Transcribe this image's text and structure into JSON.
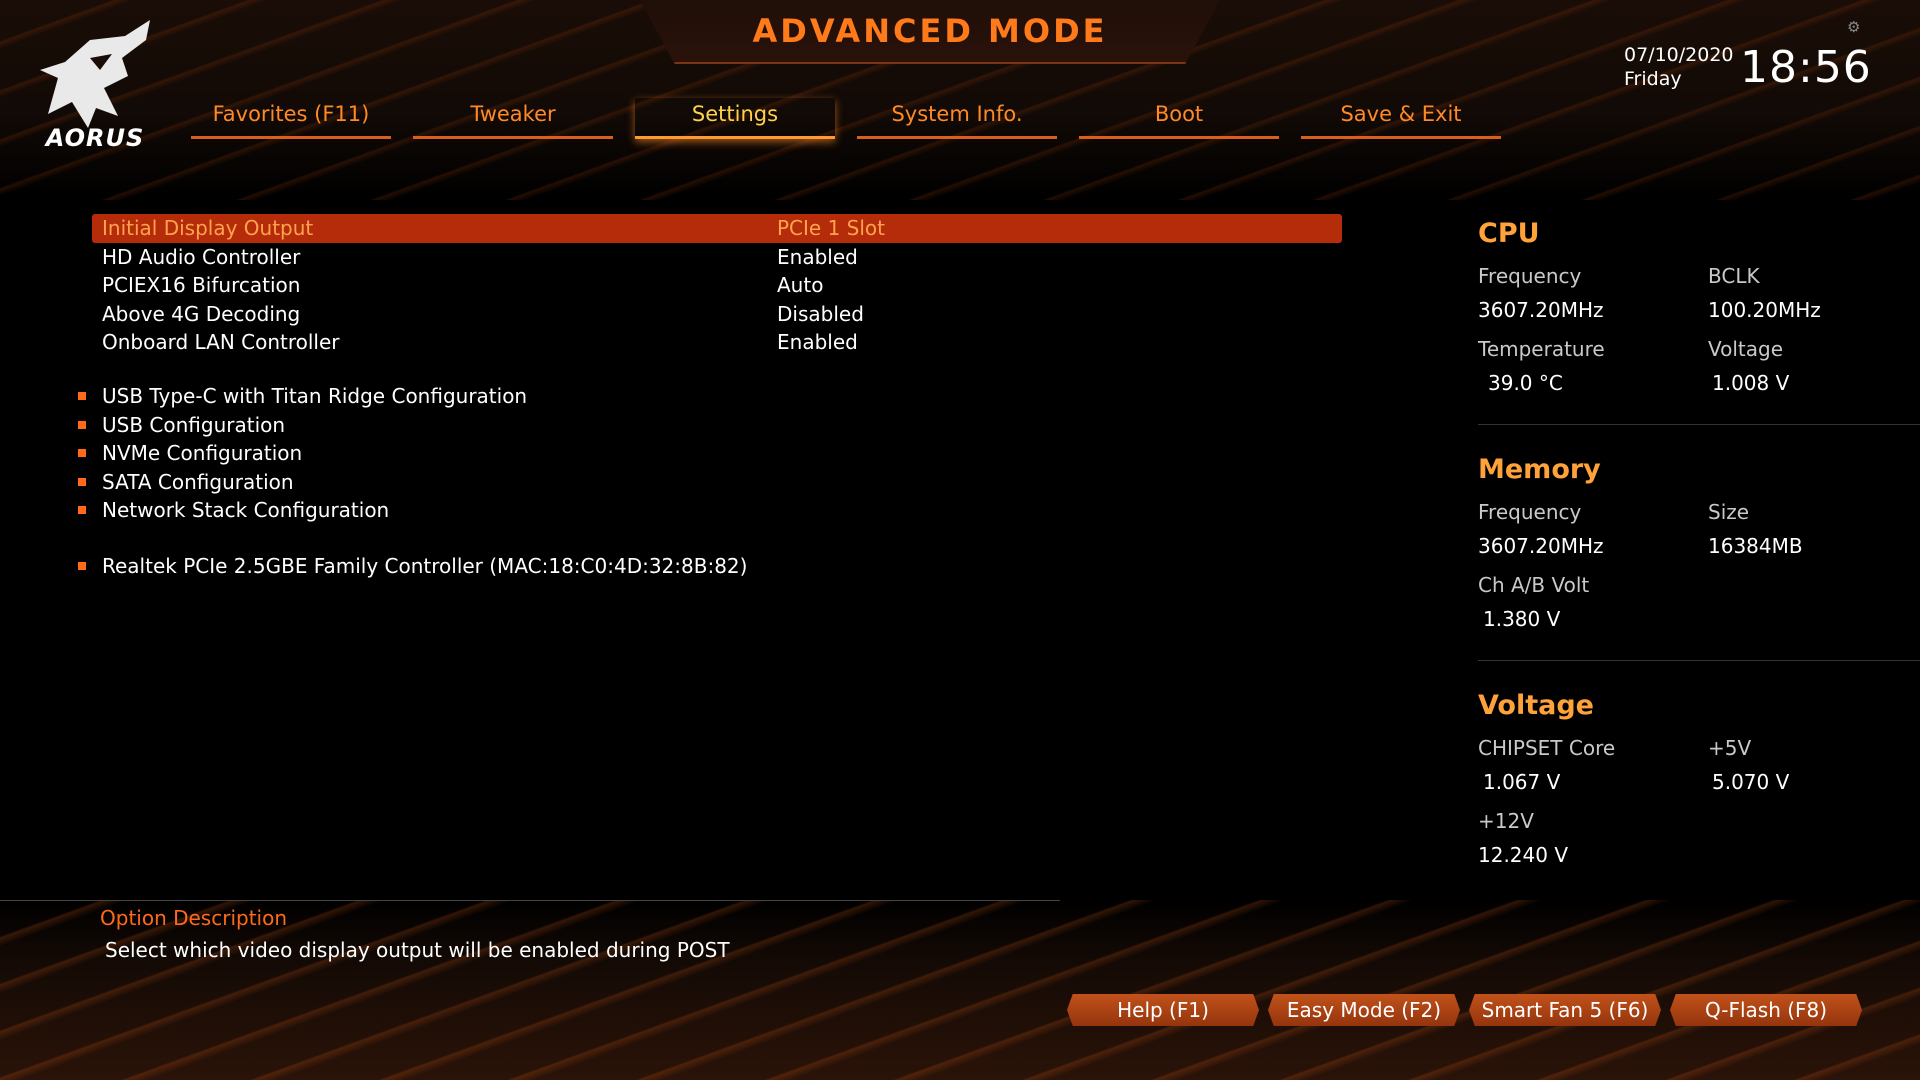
{
  "brand": {
    "logo_text": "AORUS"
  },
  "header": {
    "title": "ADVANCED MODE",
    "date": "07/10/2020",
    "day": "Friday",
    "time": "18:56"
  },
  "tabs": [
    {
      "label": "Favorites (F11)"
    },
    {
      "label": "Tweaker"
    },
    {
      "label": "Settings",
      "active": true
    },
    {
      "label": "System Info."
    },
    {
      "label": "Boot"
    },
    {
      "label": "Save & Exit"
    }
  ],
  "settings": [
    {
      "label": "Initial Display Output",
      "value": "PCIe 1 Slot",
      "selected": true
    },
    {
      "label": "HD Audio Controller",
      "value": "Enabled"
    },
    {
      "label": "PCIEX16 Bifurcation",
      "value": "Auto"
    },
    {
      "label": "Above 4G Decoding",
      "value": "Disabled"
    },
    {
      "label": "Onboard LAN Controller",
      "value": "Enabled"
    }
  ],
  "submenus": [
    {
      "label": "USB Type-C with Titan Ridge Configuration"
    },
    {
      "label": "USB Configuration"
    },
    {
      "label": "NVMe Configuration"
    },
    {
      "label": "SATA Configuration"
    },
    {
      "label": "Network Stack Configuration"
    }
  ],
  "network_devices": [
    {
      "label": "Realtek PCIe 2.5GBE Family Controller (MAC:18:C0:4D:32:8B:82)"
    }
  ],
  "description": {
    "title": "Option Description",
    "text": "Select which video display output will be enabled during POST"
  },
  "cpu": {
    "heading": "CPU",
    "freq_label": "Frequency",
    "freq_value": "3607.20MHz",
    "bclk_label": "BCLK",
    "bclk_value": "100.20MHz",
    "temp_label": "Temperature",
    "temp_value": "39.0 °C",
    "volt_label": "Voltage",
    "volt_value": "1.008 V"
  },
  "memory": {
    "heading": "Memory",
    "freq_label": "Frequency",
    "freq_value": "3607.20MHz",
    "size_label": "Size",
    "size_value": "16384MB",
    "chvolt_label": "Ch A/B Volt",
    "chvolt_value": "1.380 V"
  },
  "voltage": {
    "heading": "Voltage",
    "chipset_label": "CHIPSET Core",
    "chipset_value": "1.067 V",
    "v5_label": "+5V",
    "v5_value": "5.070 V",
    "v12_label": "+12V",
    "v12_value": "12.240 V"
  },
  "function_keys": [
    {
      "label": "Help (F1)"
    },
    {
      "label": "Easy Mode (F2)"
    },
    {
      "label": "Smart Fan 5 (F6)"
    },
    {
      "label": "Q-Flash (F8)"
    }
  ],
  "colors": {
    "accent": "#ff7a1a",
    "active_tab": "#ffd24a",
    "selection": "#b52c0a",
    "panel_heading": "#ffa23a"
  }
}
